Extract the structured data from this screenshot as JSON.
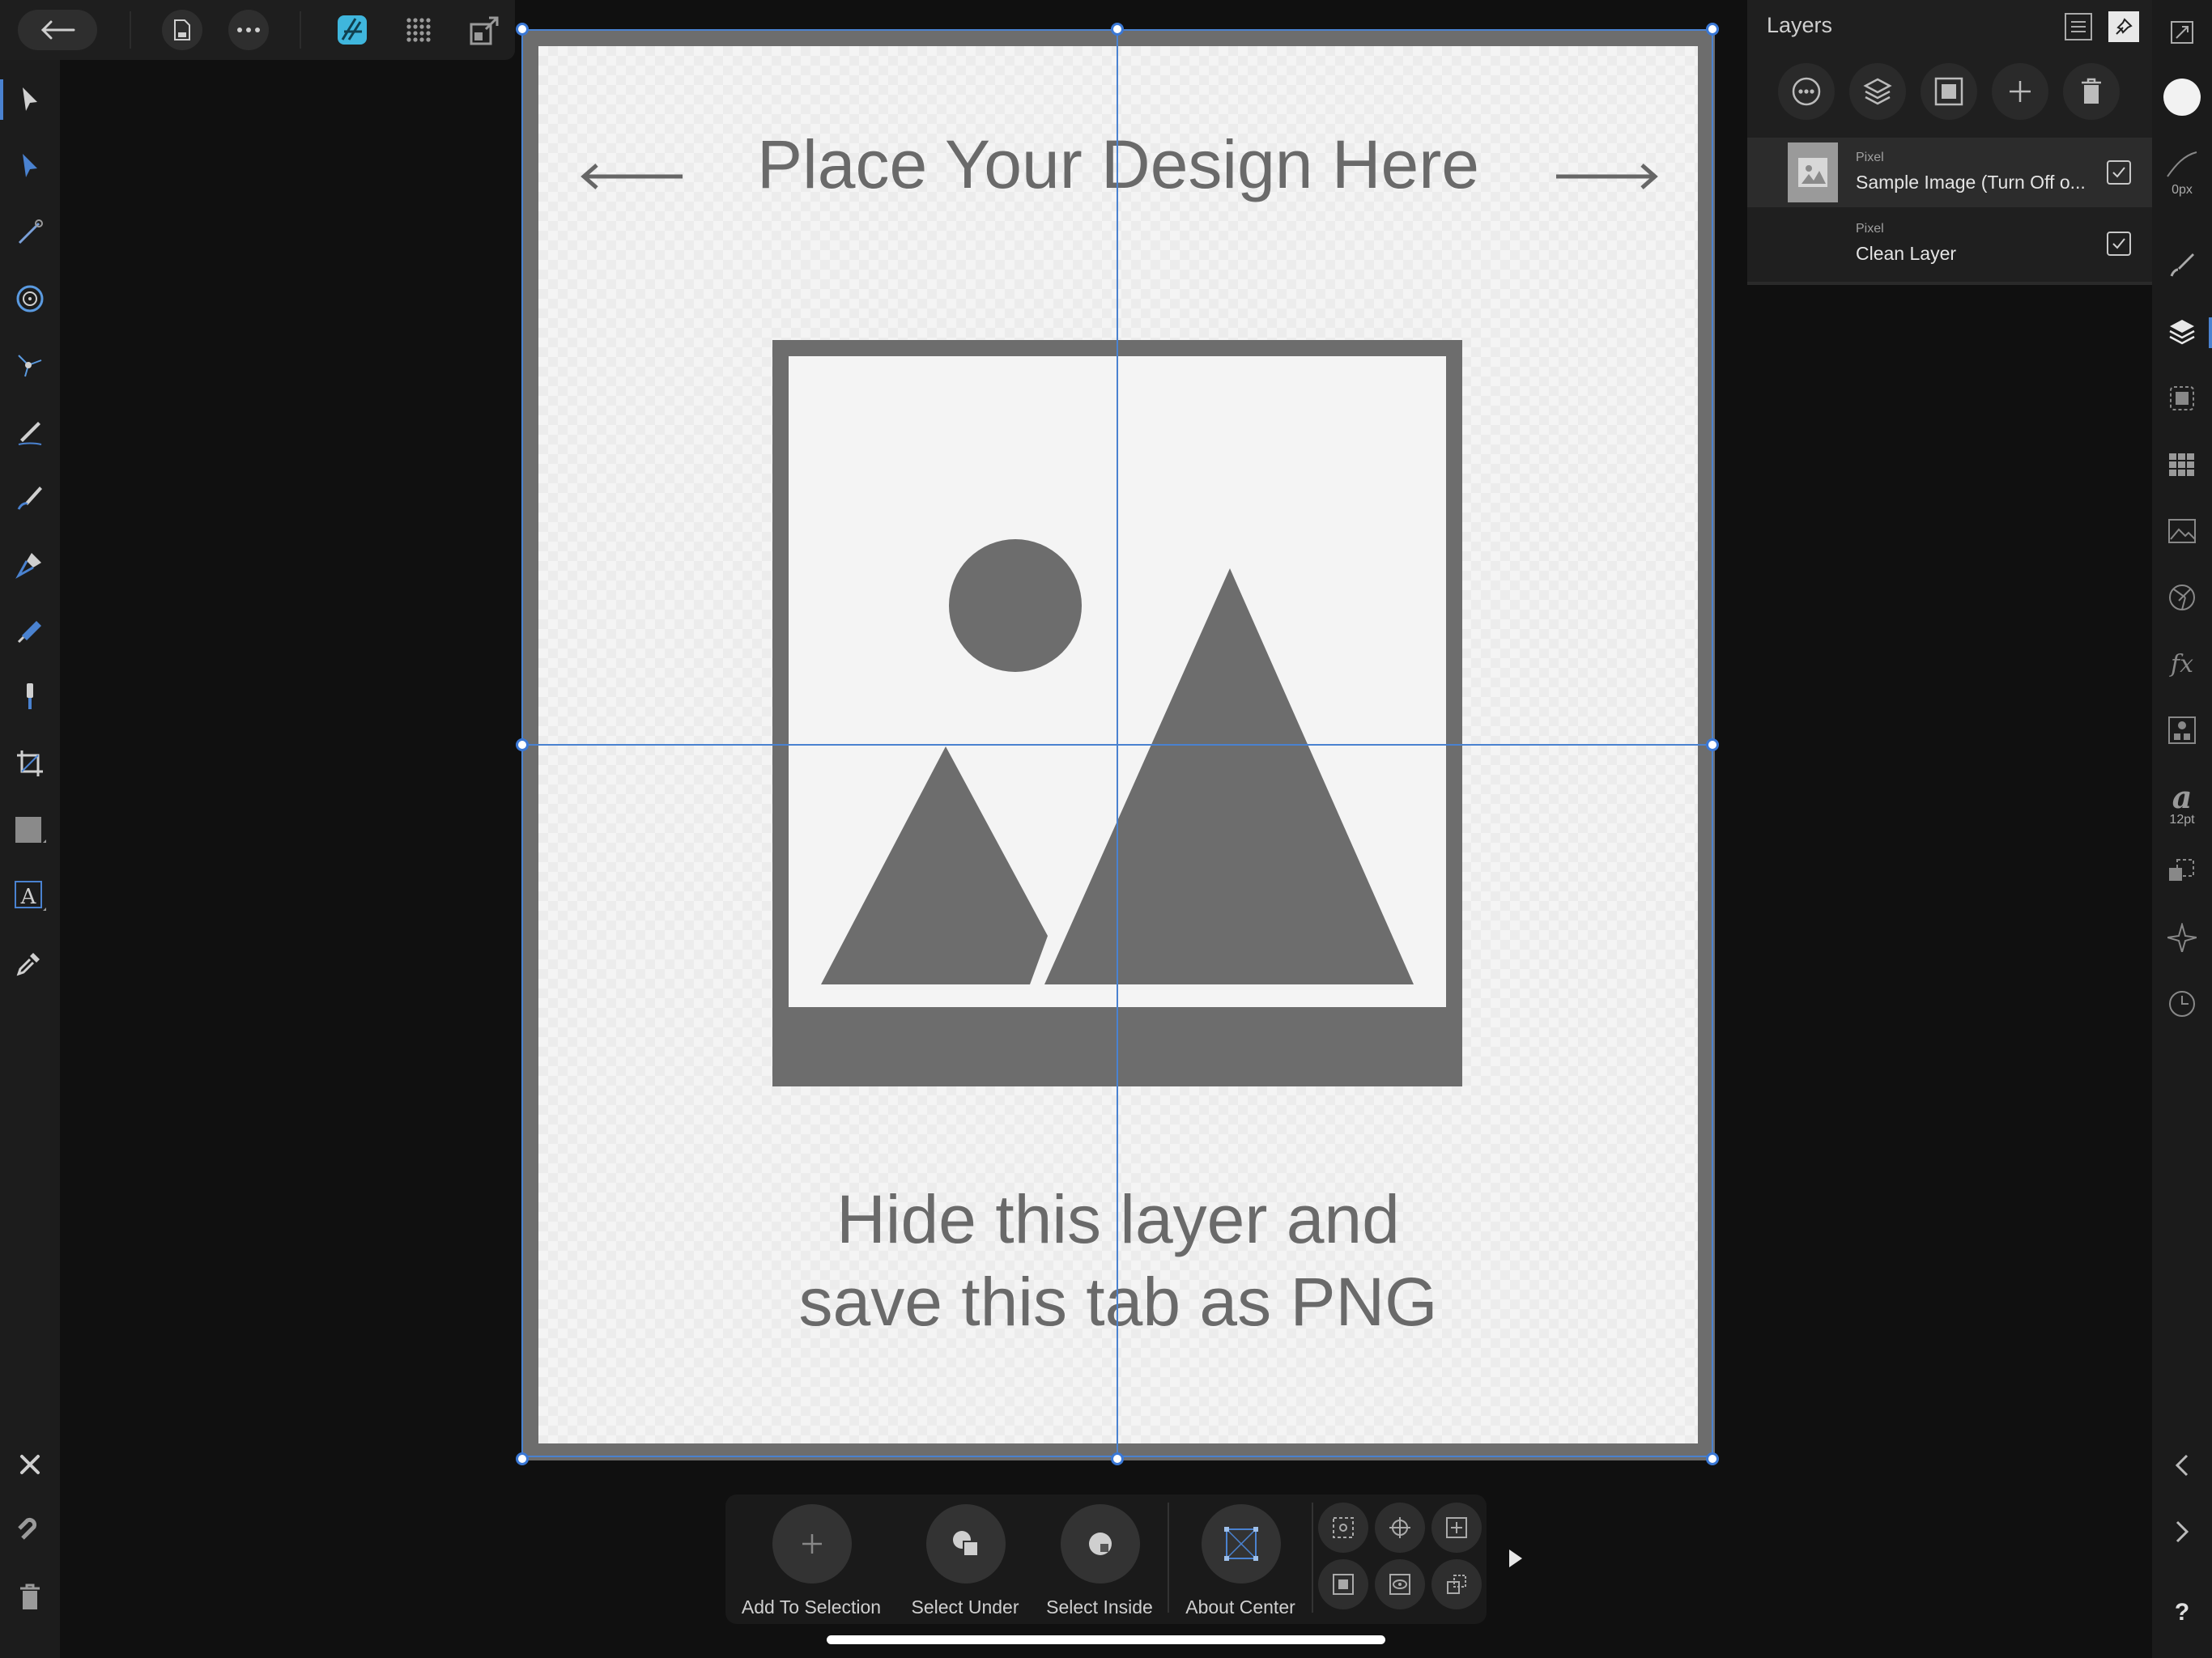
{
  "canvas": {
    "title_text": "Place Your Design Here",
    "note_line1": "Hide this layer and",
    "note_line2": "save this tab as PNG"
  },
  "layers_panel": {
    "title": "Layers",
    "layers": [
      {
        "kind": "Pixel",
        "name": "Sample Image (Turn Off o...",
        "visible": true,
        "selected": true
      },
      {
        "kind": "Pixel",
        "name": "Clean Layer",
        "visible": true,
        "selected": false
      }
    ]
  },
  "right_strip": {
    "stroke_width": "0px",
    "font_size": "12pt"
  },
  "context_toolbar": {
    "add_to_selection": "Add To Selection",
    "select_under": "Select Under",
    "select_inside": "Select Inside",
    "about_center": "About Center"
  },
  "colors": {
    "accent": "#4a82d0",
    "affinity_brand": "#3fb6dd",
    "placeholder_gray": "#6d6d6d"
  }
}
